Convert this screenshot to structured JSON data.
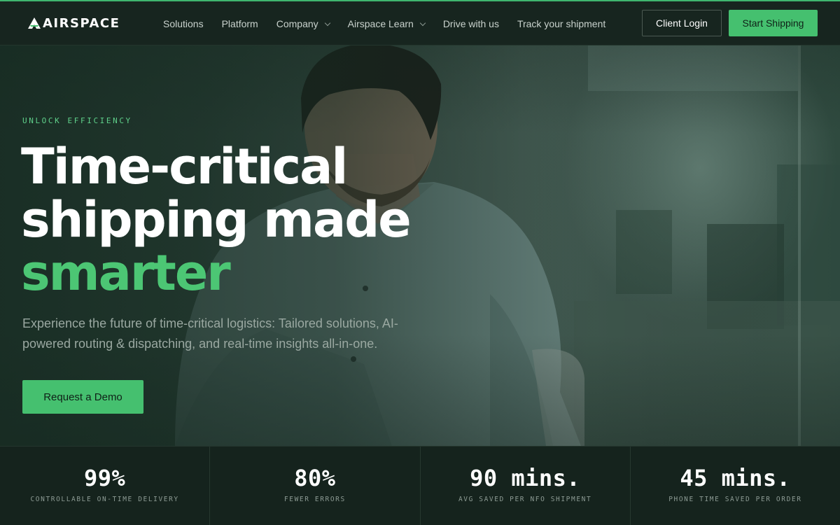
{
  "brand": {
    "name": "AIRSPACE"
  },
  "nav": {
    "links": [
      {
        "label": "Solutions",
        "dropdown": false
      },
      {
        "label": "Platform",
        "dropdown": false
      },
      {
        "label": "Company",
        "dropdown": true
      },
      {
        "label": "Airspace Learn",
        "dropdown": true
      },
      {
        "label": "Drive with us",
        "dropdown": false
      },
      {
        "label": "Track your shipment",
        "dropdown": false
      }
    ],
    "client_login": "Client Login",
    "start_shipping": "Start Shipping"
  },
  "hero": {
    "eyebrow": "UNLOCK EFFICIENCY",
    "headline_line1": "Time-critical",
    "headline_line2": "shipping made",
    "headline_accent": "smarter",
    "subtext": "Experience the future of time-critical logistics: Tailored solutions, AI-powered routing & dispatching, and real-time insights all-in-one.",
    "cta": "Request a Demo",
    "image": "man-working-at-laptop-photo"
  },
  "stats": [
    {
      "value": "99%",
      "label": "CONTROLLABLE ON-TIME DELIVERY"
    },
    {
      "value": "80%",
      "label": "FEWER ERRORS"
    },
    {
      "value": "90 mins.",
      "label": "AVG SAVED PER NFO SHIPMENT"
    },
    {
      "value": "45 mins.",
      "label": "PHONE TIME SAVED PER ORDER"
    }
  ],
  "colors": {
    "accent": "#45c06f",
    "nav_bg": "#17251f",
    "stats_bg": "#15231d",
    "eyebrow": "#5fd08a"
  }
}
